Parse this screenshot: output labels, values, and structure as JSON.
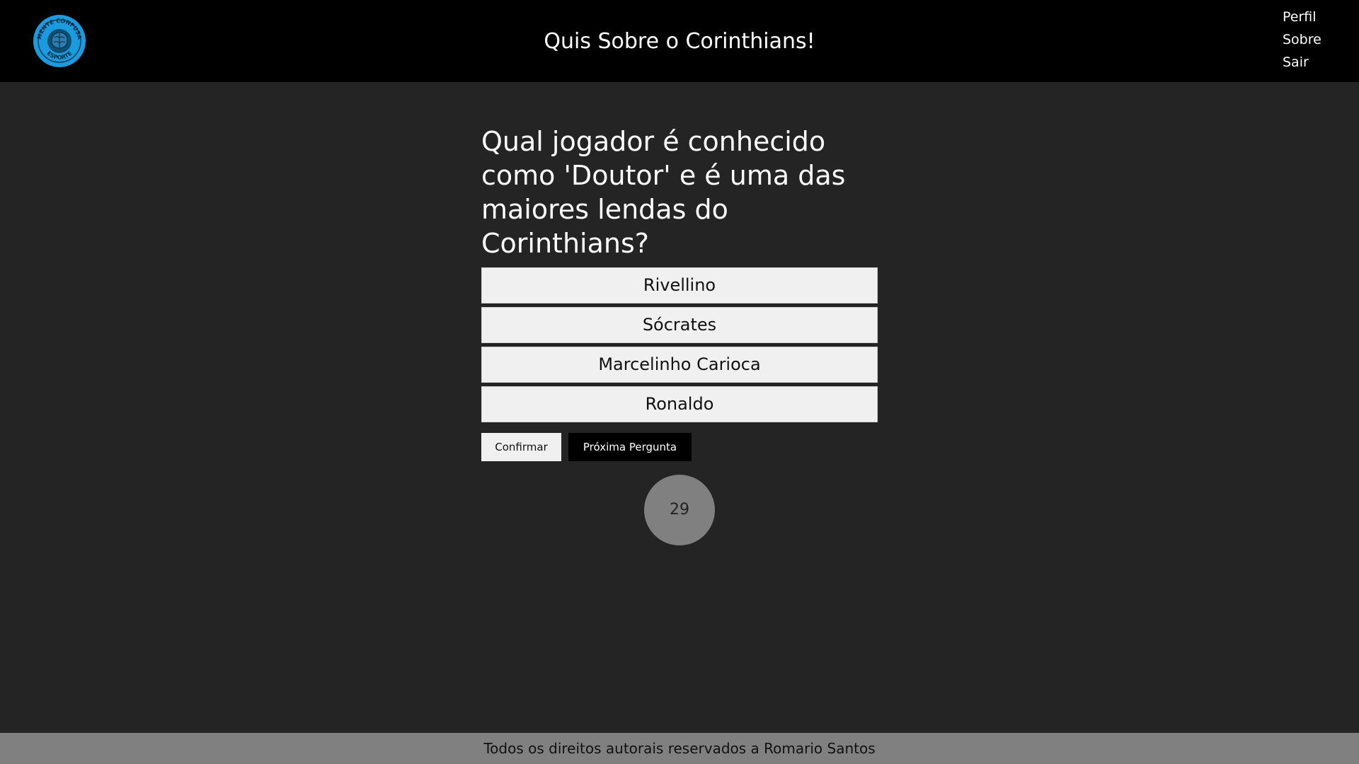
{
  "header": {
    "title": "Quis Sobre o Corinthians!",
    "logo": {
      "top_text": "MENTE CONFUSA",
      "bottom_text": "ESPORTE",
      "accent_color": "#1a9be0"
    },
    "nav": [
      "Perfil",
      "Sobre",
      "Sair"
    ]
  },
  "quiz": {
    "question": "Qual jogador é conhecido como 'Doutor' e é uma das maiores lendas do Corinthians?",
    "answers": [
      "Rivellino",
      "Sócrates",
      "Marcelinho Carioca",
      "Ronaldo"
    ],
    "confirm_label": "Confirmar",
    "next_label": "Próxima Pergunta",
    "timer": "29"
  },
  "footer": {
    "text": "Todos os direitos autorais reservados a Romario Santos"
  },
  "colors": {
    "background": "#242424",
    "header": "#000000",
    "footer": "#808080",
    "answer_bg": "#f0f0f0",
    "timer_bg": "#808080"
  }
}
